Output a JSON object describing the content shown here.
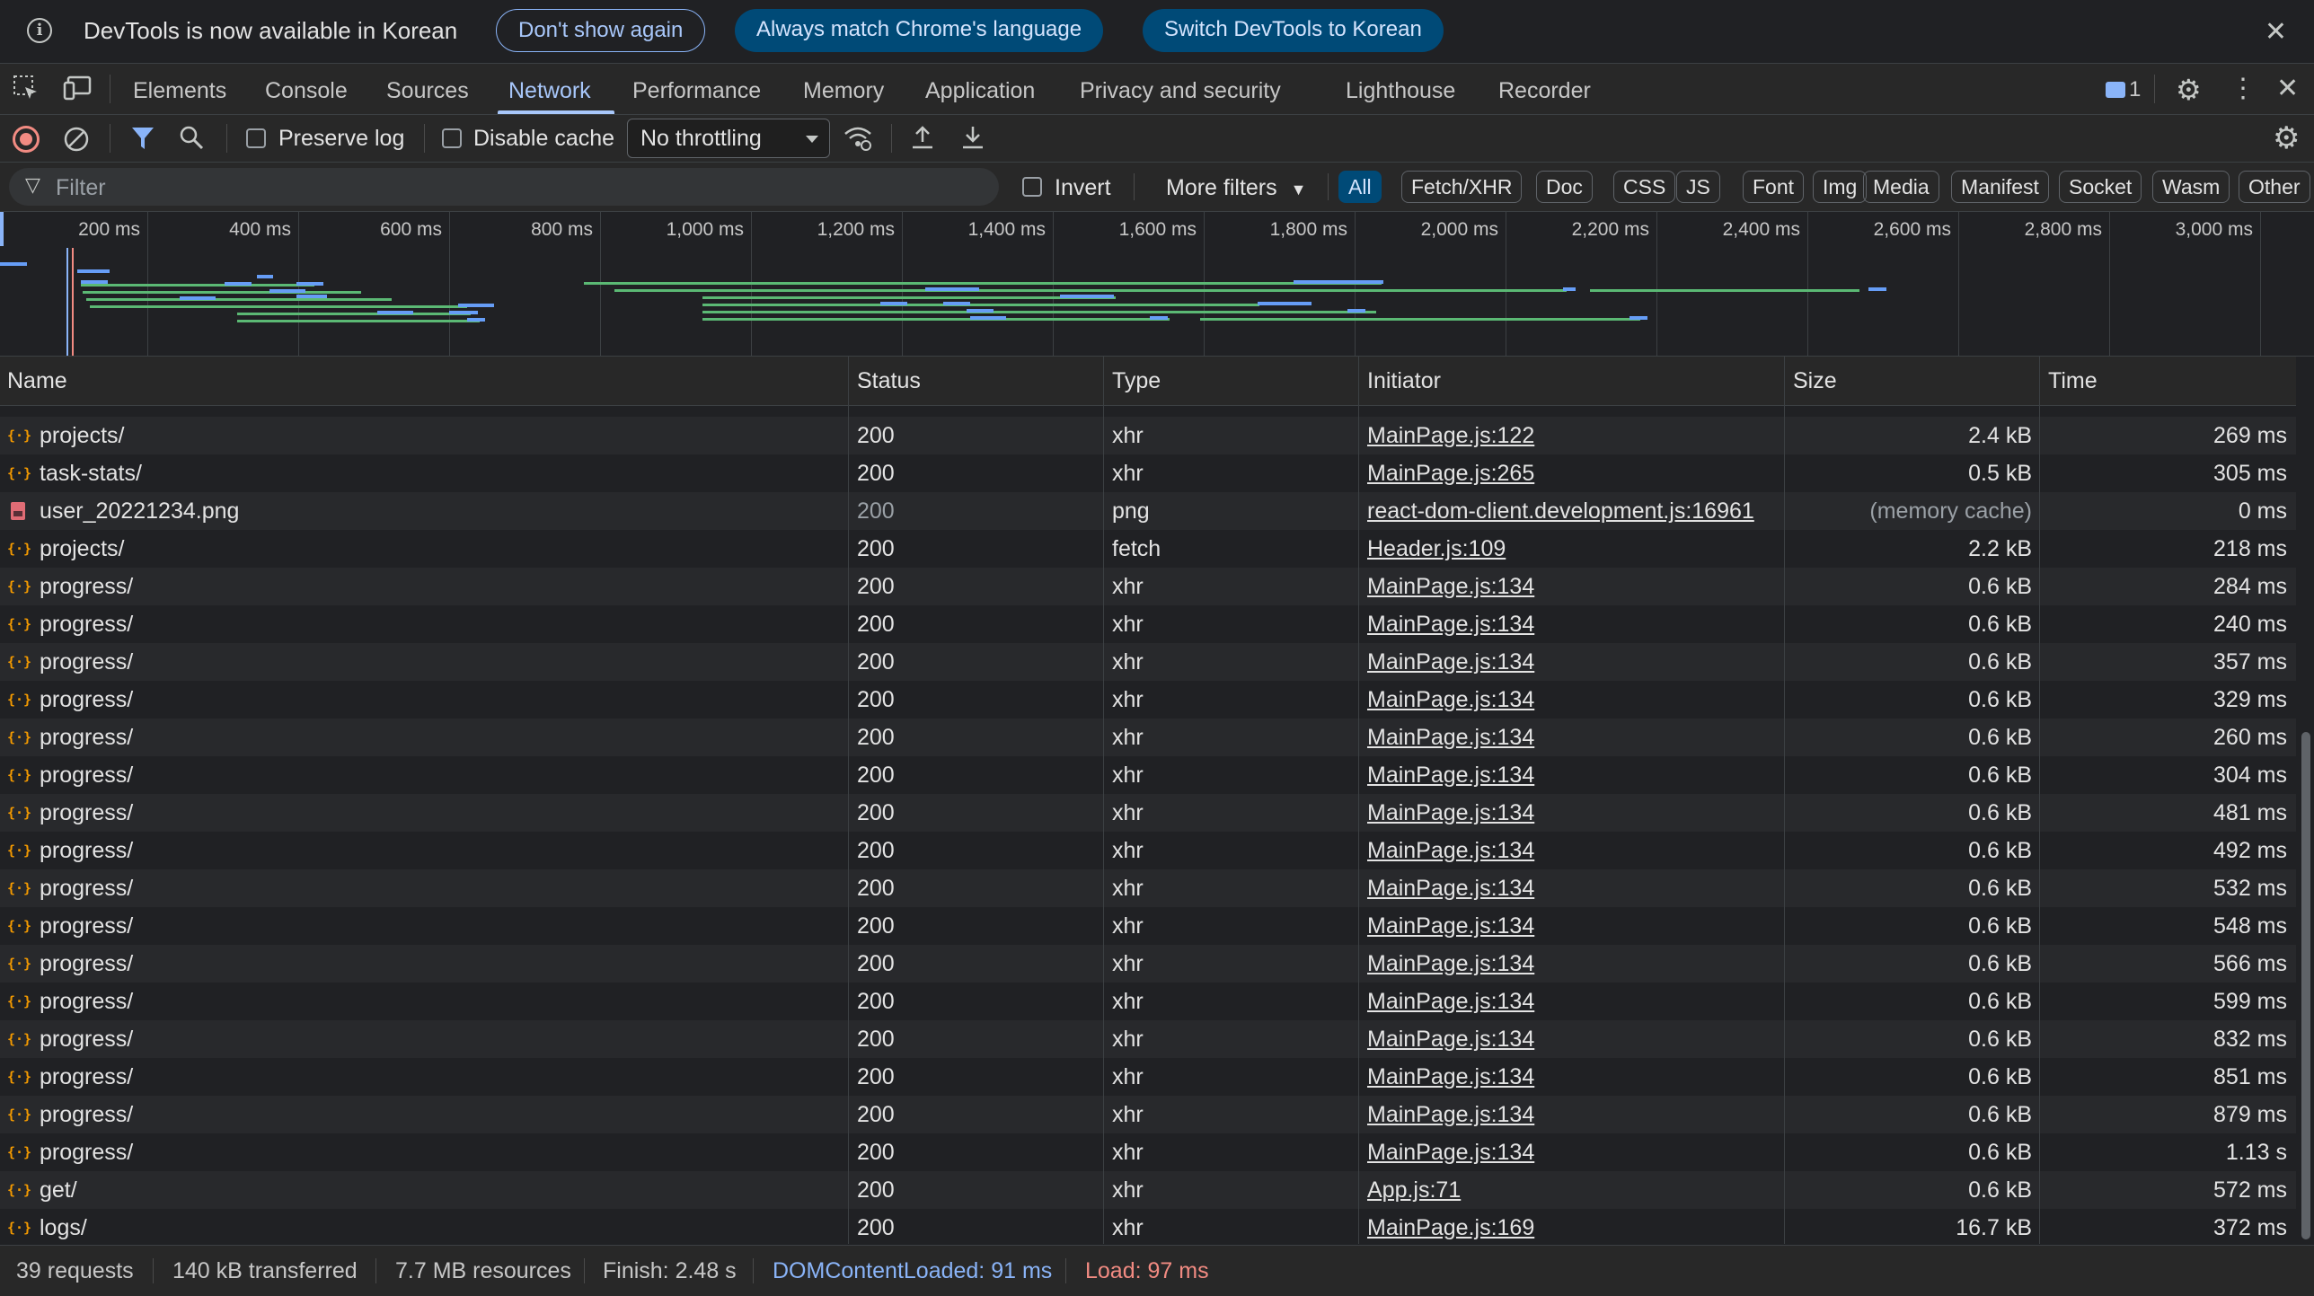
{
  "infobar": {
    "message": "DevTools is now available in Korean",
    "dont_show": "Don't show again",
    "always_match": "Always match Chrome's language",
    "switch": "Switch DevTools to Korean"
  },
  "tabs": [
    "Elements",
    "Console",
    "Sources",
    "Network",
    "Performance",
    "Memory",
    "Application",
    "Privacy and security",
    "Lighthouse",
    "Recorder"
  ],
  "active_tab": "Network",
  "issues_count": "1",
  "toolbar": {
    "preserve_log": "Preserve log",
    "disable_cache": "Disable cache",
    "throttling": "No throttling"
  },
  "filter": {
    "placeholder": "Filter",
    "invert": "Invert",
    "more_filters": "More filters",
    "chips": [
      "All",
      "Fetch/XHR",
      "Doc",
      "CSS",
      "JS",
      "Font",
      "Img",
      "Media",
      "Manifest",
      "Socket",
      "Wasm",
      "Other"
    ]
  },
  "timeline_ticks": [
    "200 ms",
    "400 ms",
    "600 ms",
    "800 ms",
    "1,000 ms",
    "1,200 ms",
    "1,400 ms",
    "1,600 ms",
    "1,800 ms",
    "2,000 ms",
    "2,200 ms",
    "2,400 ms",
    "2,600 ms",
    "2,800 ms",
    "3,000 ms"
  ],
  "columns": [
    "Name",
    "Status",
    "Type",
    "Initiator",
    "Size",
    "Time"
  ],
  "rows": [
    {
      "name": "projects/",
      "status": "200",
      "type": "xhr",
      "initiator": "MainPage.js:122",
      "size": "2.4 kB",
      "time": "269 ms",
      "icon": "xhr-icon"
    },
    {
      "name": "task-stats/",
      "status": "200",
      "type": "xhr",
      "initiator": "MainPage.js:265",
      "size": "0.5 kB",
      "time": "305 ms",
      "icon": "xhr-icon"
    },
    {
      "name": "user_20221234.png",
      "status": "200",
      "type": "png",
      "initiator": "react-dom-client.development.js:16961",
      "size": "(memory cache)",
      "time": "0 ms",
      "icon": "image-icon"
    },
    {
      "name": "projects/",
      "status": "200",
      "type": "fetch",
      "initiator": "Header.js:109",
      "size": "2.2 kB",
      "time": "218 ms",
      "icon": "xhr-icon"
    },
    {
      "name": "progress/",
      "status": "200",
      "type": "xhr",
      "initiator": "MainPage.js:134",
      "size": "0.6 kB",
      "time": "284 ms",
      "icon": "xhr-icon"
    },
    {
      "name": "progress/",
      "status": "200",
      "type": "xhr",
      "initiator": "MainPage.js:134",
      "size": "0.6 kB",
      "time": "240 ms",
      "icon": "xhr-icon"
    },
    {
      "name": "progress/",
      "status": "200",
      "type": "xhr",
      "initiator": "MainPage.js:134",
      "size": "0.6 kB",
      "time": "357 ms",
      "icon": "xhr-icon"
    },
    {
      "name": "progress/",
      "status": "200",
      "type": "xhr",
      "initiator": "MainPage.js:134",
      "size": "0.6 kB",
      "time": "329 ms",
      "icon": "xhr-icon"
    },
    {
      "name": "progress/",
      "status": "200",
      "type": "xhr",
      "initiator": "MainPage.js:134",
      "size": "0.6 kB",
      "time": "260 ms",
      "icon": "xhr-icon"
    },
    {
      "name": "progress/",
      "status": "200",
      "type": "xhr",
      "initiator": "MainPage.js:134",
      "size": "0.6 kB",
      "time": "304 ms",
      "icon": "xhr-icon"
    },
    {
      "name": "progress/",
      "status": "200",
      "type": "xhr",
      "initiator": "MainPage.js:134",
      "size": "0.6 kB",
      "time": "481 ms",
      "icon": "xhr-icon"
    },
    {
      "name": "progress/",
      "status": "200",
      "type": "xhr",
      "initiator": "MainPage.js:134",
      "size": "0.6 kB",
      "time": "492 ms",
      "icon": "xhr-icon"
    },
    {
      "name": "progress/",
      "status": "200",
      "type": "xhr",
      "initiator": "MainPage.js:134",
      "size": "0.6 kB",
      "time": "532 ms",
      "icon": "xhr-icon"
    },
    {
      "name": "progress/",
      "status": "200",
      "type": "xhr",
      "initiator": "MainPage.js:134",
      "size": "0.6 kB",
      "time": "548 ms",
      "icon": "xhr-icon"
    },
    {
      "name": "progress/",
      "status": "200",
      "type": "xhr",
      "initiator": "MainPage.js:134",
      "size": "0.6 kB",
      "time": "566 ms",
      "icon": "xhr-icon"
    },
    {
      "name": "progress/",
      "status": "200",
      "type": "xhr",
      "initiator": "MainPage.js:134",
      "size": "0.6 kB",
      "time": "599 ms",
      "icon": "xhr-icon"
    },
    {
      "name": "progress/",
      "status": "200",
      "type": "xhr",
      "initiator": "MainPage.js:134",
      "size": "0.6 kB",
      "time": "832 ms",
      "icon": "xhr-icon"
    },
    {
      "name": "progress/",
      "status": "200",
      "type": "xhr",
      "initiator": "MainPage.js:134",
      "size": "0.6 kB",
      "time": "851 ms",
      "icon": "xhr-icon"
    },
    {
      "name": "progress/",
      "status": "200",
      "type": "xhr",
      "initiator": "MainPage.js:134",
      "size": "0.6 kB",
      "time": "879 ms",
      "icon": "xhr-icon"
    },
    {
      "name": "progress/",
      "status": "200",
      "type": "xhr",
      "initiator": "MainPage.js:134",
      "size": "0.6 kB",
      "time": "1.13 s",
      "icon": "xhr-icon"
    },
    {
      "name": "get/",
      "status": "200",
      "type": "xhr",
      "initiator": "App.js:71",
      "size": "0.6 kB",
      "time": "572 ms",
      "icon": "xhr-icon"
    },
    {
      "name": "logs/",
      "status": "200",
      "type": "xhr",
      "initiator": "MainPage.js:169",
      "size": "16.7 kB",
      "time": "372 ms",
      "icon": "xhr-icon"
    }
  ],
  "status_bar": {
    "requests": "39 requests",
    "transferred": "140 kB transferred",
    "resources": "7.7 MB resources",
    "finish": "Finish: 2.48 s",
    "dom_content_loaded": "DOMContentLoaded: 91 ms",
    "load": "Load: 97 ms"
  },
  "colors": {
    "accent": "#a8c7fa",
    "waterfall_waiting": "#5bb974",
    "waterfall_download": "#669df6",
    "dcl": "#8ab4f8",
    "load": "#f28b82"
  }
}
